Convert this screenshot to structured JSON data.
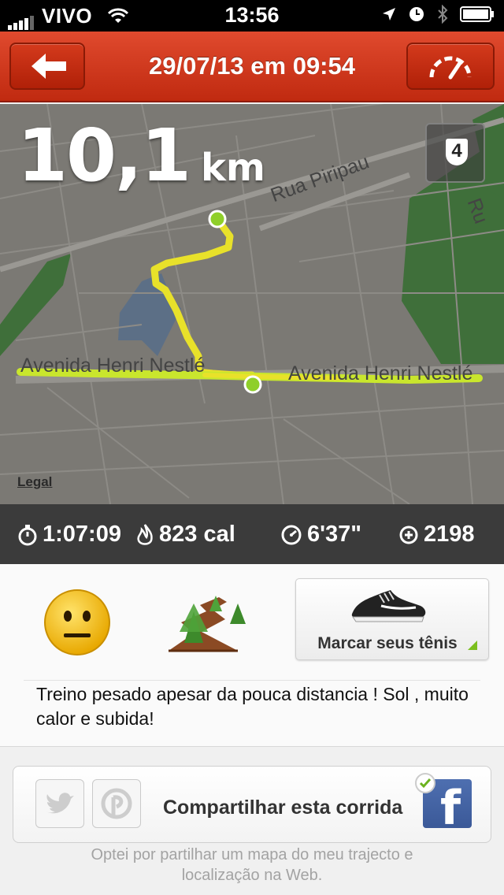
{
  "status_bar": {
    "carrier": "VIVO",
    "time": "13:56",
    "icons": [
      "signal-bars-icon",
      "wifi-icon",
      "location-arrow-icon",
      "clock-icon",
      "bluetooth-icon",
      "battery-icon"
    ]
  },
  "header": {
    "title": "29/07/13 em 09:54",
    "back_icon": "back-arrow-icon",
    "right_icon": "speedometer-icon"
  },
  "map": {
    "distance_value": "10,1",
    "distance_unit": "km",
    "badge_number": "4",
    "legal_label": "Legal",
    "streets": [
      "Rua Piripau",
      "Avenida Henri Nestlé",
      "Avenida Henri Nestlé",
      "Ru"
    ]
  },
  "stats": {
    "duration": "1:07:09",
    "calories": "823 cal",
    "pace": "6'37\"",
    "fuel": "2198"
  },
  "details": {
    "mood_icon": "neutral-face-icon",
    "terrain_icon": "trail-icon",
    "shoe_button_label": "Marcar seus tênis",
    "note": "Treino pesado apesar da pouca distancia ! Sol , muito calor e subida!"
  },
  "share": {
    "label": "Compartilhar esta corrida",
    "services": [
      "twitter",
      "pinterest",
      "facebook"
    ],
    "footer": "Optei por partilhar um mapa do meu trajecto e localização na Web."
  },
  "colors": {
    "header_red": "#d43a1c",
    "route_yellow": "#e8e12a",
    "route_green": "#b8e02a",
    "stats_bg": "#3b3b3b",
    "facebook_blue": "#3b5998",
    "accent_green": "#7cbf1e"
  }
}
